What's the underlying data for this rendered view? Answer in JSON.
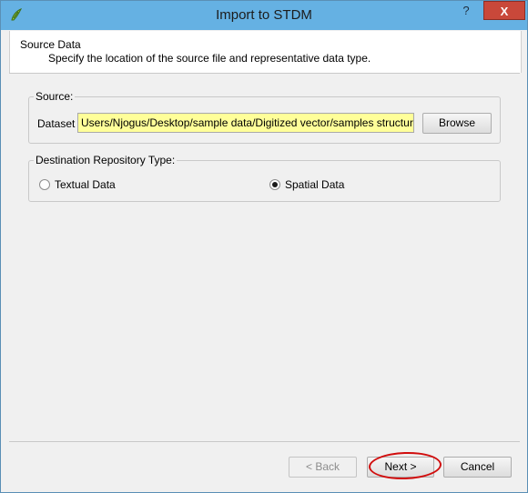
{
  "window": {
    "title": "Import to STDM",
    "help_label": "?",
    "close_label": "X"
  },
  "header": {
    "title": "Source Data",
    "subtitle": "Specify the location of the source file and representative data type."
  },
  "source_group": {
    "title": "Source:",
    "dataset_label": "Dataset",
    "dataset_value": "Users/Njogus/Desktop/sample data/Digitized vector/samples structures.shp",
    "browse_label": "Browse"
  },
  "destination_group": {
    "title": "Destination Repository Type:",
    "options": [
      {
        "label": "Textual Data",
        "checked": false
      },
      {
        "label": "Spatial Data",
        "checked": true
      }
    ]
  },
  "footer": {
    "back_label": "< Back",
    "next_label": "Next >",
    "cancel_label": "Cancel"
  },
  "colors": {
    "titlebar": "#65b1e3",
    "close_button": "#c9483a",
    "dataset_highlight": "#ffff99",
    "annotation_ring": "#d10d0d"
  }
}
